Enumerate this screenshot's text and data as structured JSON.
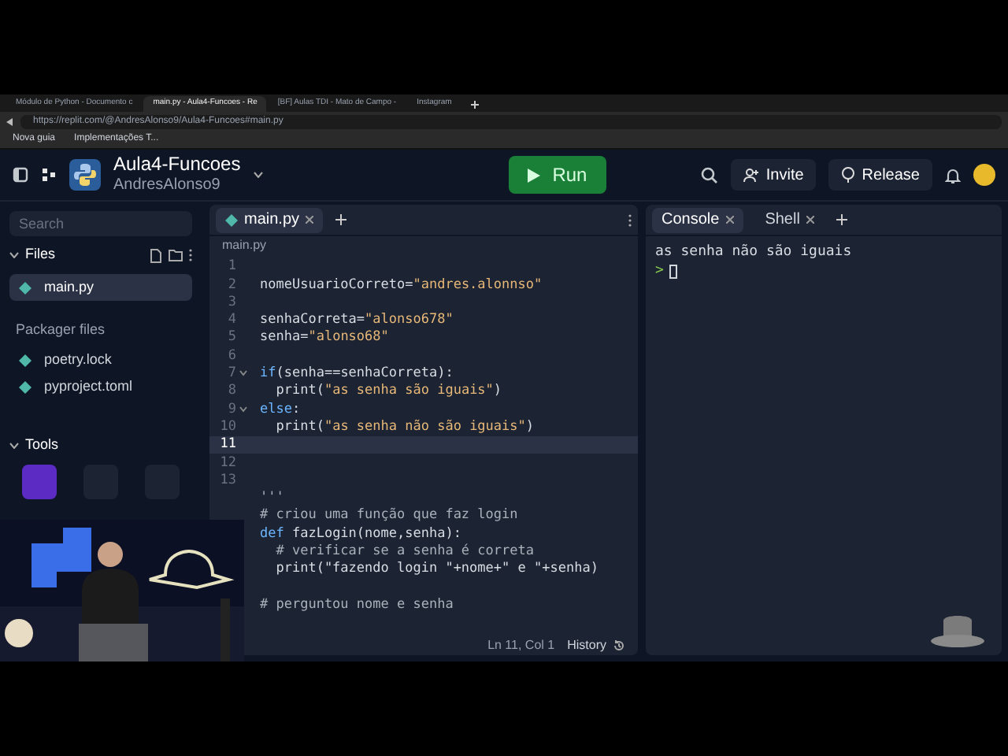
{
  "browser": {
    "tabs": [
      {
        "label": "Módulo de Python - Documento c",
        "selected": false
      },
      {
        "label": "main.py - Aula4-Funcoes - Re",
        "selected": true
      },
      {
        "label": "[BF] Aulas TDI - Mato de Campo - ",
        "selected": false
      },
      {
        "label": "Instagram",
        "selected": false
      }
    ],
    "address": "https://replit.com/@AndresAlonso9/Aula4-Funcoes#main.py",
    "bookmarks": [
      "Nova guia",
      "Implementações T..."
    ]
  },
  "header": {
    "repl_name": "Aula4-Funcoes",
    "owner": "AndresAlonso9",
    "run_button": "Run",
    "invite_button": "Invite",
    "release_button": "Release"
  },
  "sidebar": {
    "search": {
      "placeholder": "Search"
    },
    "files_heading": "Files",
    "files": [
      {
        "name": "main.py",
        "selected": true
      }
    ],
    "packager_heading": "Packager files",
    "packager_files": [
      {
        "name": "poetry.lock",
        "selected": false
      },
      {
        "name": "pyproject.toml",
        "selected": false
      }
    ],
    "tools_heading": "Tools"
  },
  "editor": {
    "tab": "main.py",
    "breadcrumb": "main.py",
    "lines": [
      {
        "number": "1",
        "current": false,
        "foldable": false
      },
      {
        "number": "2",
        "current": false,
        "foldable": false,
        "tokens": [
          {
            "text": "nomeUsuarioCorreto=",
            "kind": "plain"
          },
          {
            "text": "\"andres.alonnso\"",
            "kind": "string"
          }
        ]
      },
      {
        "number": "3",
        "current": false,
        "foldable": false
      },
      {
        "number": "4",
        "current": false,
        "foldable": false,
        "tokens": [
          {
            "text": "senhaCorreta=",
            "kind": "plain"
          },
          {
            "text": "\"alonso678\"",
            "kind": "string"
          }
        ]
      },
      {
        "number": "5",
        "current": false,
        "foldable": false,
        "tokens": [
          {
            "text": "senha=",
            "kind": "plain"
          },
          {
            "text": "\"alonso68\"",
            "kind": "string"
          }
        ]
      },
      {
        "number": "6",
        "current": false,
        "foldable": false
      },
      {
        "number": "7",
        "current": false,
        "foldable": true,
        "tokens": [
          {
            "text": "if",
            "kind": "keyword"
          },
          {
            "text": "(senha==senhaCorreta):",
            "kind": "plain"
          }
        ]
      },
      {
        "number": "8",
        "current": false,
        "foldable": false,
        "tokens": [
          {
            "text": "  print(",
            "kind": "plain"
          },
          {
            "text": "\"as senha são iguais\"",
            "kind": "string"
          },
          {
            "text": ")",
            "kind": "plain"
          }
        ]
      },
      {
        "number": "9",
        "current": false,
        "foldable": true,
        "tokens": [
          {
            "text": "else",
            "kind": "keyword"
          },
          {
            "text": ":",
            "kind": "plain"
          }
        ]
      },
      {
        "number": "10",
        "current": false,
        "foldable": false,
        "tokens": [
          {
            "text": "  print(",
            "kind": "plain"
          },
          {
            "text": "\"as senha não são iguais\"",
            "kind": "string"
          },
          {
            "text": ")",
            "kind": "plain"
          }
        ]
      },
      {
        "number": "11",
        "current": true,
        "foldable": false
      },
      {
        "number": "12",
        "current": false,
        "foldable": false
      },
      {
        "number": "13",
        "current": false,
        "foldable": false
      },
      {
        "current": false,
        "foldable": false,
        "tokens": [
          {
            "text": "'''",
            "kind": "comment"
          }
        ]
      },
      {
        "current": false,
        "foldable": false,
        "tokens": [
          {
            "text": "# criou uma função que faz login",
            "kind": "comment"
          }
        ]
      },
      {
        "current": false,
        "foldable": false,
        "tokens": [
          {
            "text": "def",
            "kind": "keyword"
          },
          {
            "text": " fazLogin(nome,senha):",
            "kind": "plain"
          }
        ]
      },
      {
        "current": false,
        "foldable": false,
        "tokens": [
          {
            "text": "  # verificar se a senha é correta",
            "kind": "comment"
          }
        ]
      },
      {
        "current": false,
        "foldable": false,
        "tokens": [
          {
            "text": "  print(\"fazendo login \"+nome+\" e \"+senha)",
            "kind": "plain"
          }
        ]
      },
      {
        "current": false,
        "foldable": false
      },
      {
        "current": false,
        "foldable": false,
        "tokens": [
          {
            "text": "# perguntou nome e senha",
            "kind": "comment"
          }
        ]
      }
    ],
    "cursor": "Ln 11, Col 1",
    "history_button": "History"
  },
  "console": {
    "tabs": [
      {
        "label": "Console",
        "selected": true
      },
      {
        "label": "Shell",
        "selected": false
      }
    ],
    "output": "as senha não são iguais",
    "prompt": ">"
  }
}
